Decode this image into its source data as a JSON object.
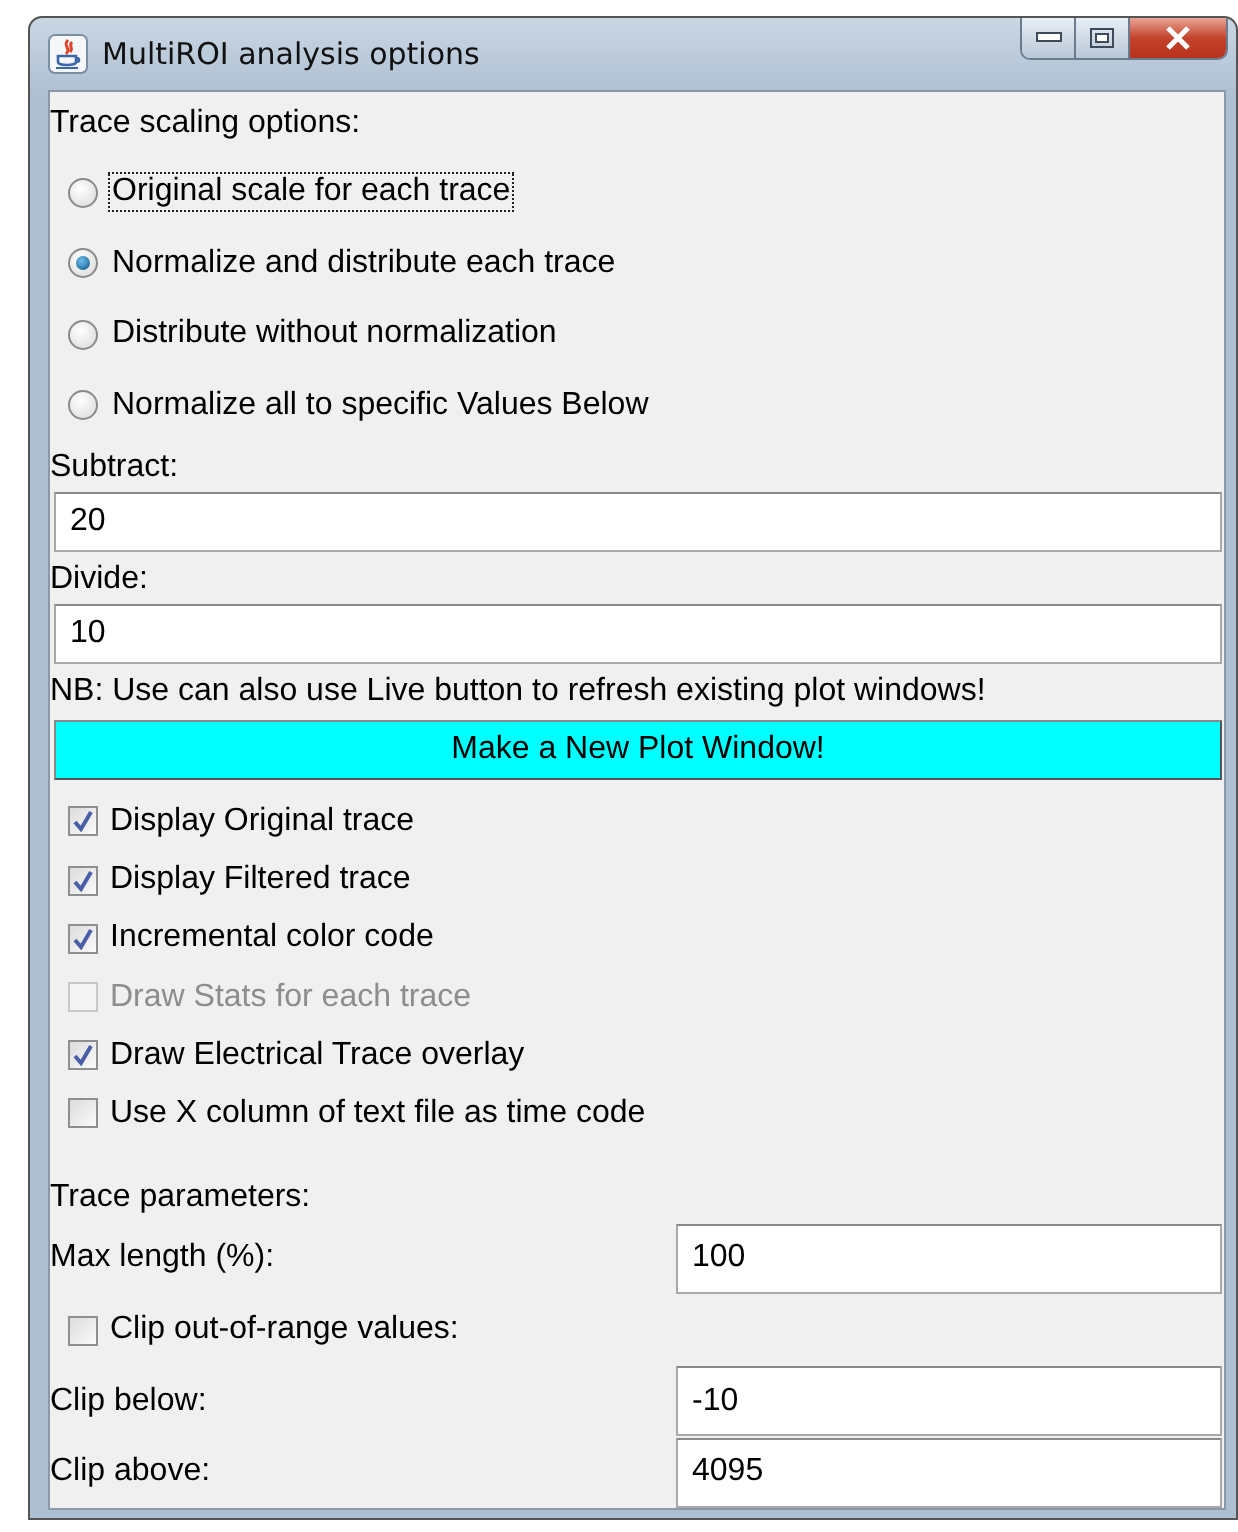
{
  "window": {
    "title": "MultiROI analysis options"
  },
  "scaling": {
    "heading": "Trace scaling options:",
    "options": [
      {
        "label": "Original scale for each trace",
        "selected": false,
        "focused": true
      },
      {
        "label": "Normalize and distribute each trace",
        "selected": true,
        "focused": false
      },
      {
        "label": "Distribute without normalization",
        "selected": false,
        "focused": false
      },
      {
        "label": "Normalize all to specific Values Below",
        "selected": false,
        "focused": false
      }
    ]
  },
  "subtract": {
    "label": "Subtract:",
    "value": "20"
  },
  "divide": {
    "label": "Divide:",
    "value": "10"
  },
  "note": "NB: Use can also use Live button to refresh existing plot windows!",
  "plot_button": "Make a New Plot Window!",
  "display_options": [
    {
      "label": "Display Original trace",
      "checked": true,
      "disabled": false
    },
    {
      "label": "Display Filtered trace",
      "checked": true,
      "disabled": false
    },
    {
      "label": "Incremental color code",
      "checked": true,
      "disabled": false
    },
    {
      "label": "Draw Stats for each trace",
      "checked": false,
      "disabled": true
    },
    {
      "label": "Draw Electrical Trace overlay",
      "checked": true,
      "disabled": false
    },
    {
      "label": "Use X column of text file as time code",
      "checked": false,
      "disabled": false
    }
  ],
  "trace_parameters": {
    "heading": "Trace parameters:",
    "max_length": {
      "label": "Max length (%):",
      "value": "100"
    },
    "clip": {
      "label": "Clip out-of-range values:",
      "checked": false,
      "disabled": false
    },
    "clip_below": {
      "label": "Clip below:",
      "value": "-10"
    },
    "clip_above": {
      "label": "Clip above:",
      "value": "4095"
    }
  }
}
